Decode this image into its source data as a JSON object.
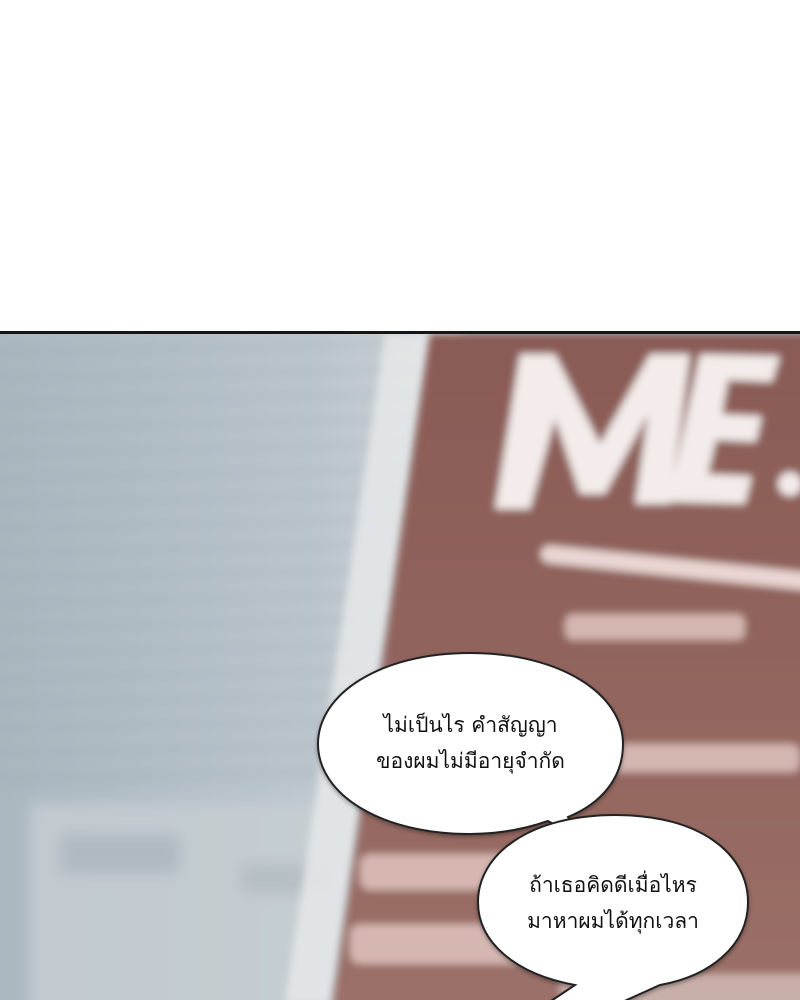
{
  "panel": {
    "sign_text": "ME",
    "bubbles": [
      {
        "lines": [
          "ไม่เป็นไร คำสัญญา",
          "ของผมไม่มีอายุจำกัด"
        ]
      },
      {
        "lines": [
          "ถ้าเธอคิดดีเมื่อไหร",
          "มาหาผมได้ทุกเวลา"
        ]
      }
    ]
  },
  "colors": {
    "wall_left": "#b4c0c8",
    "sign_board": "#8b5e5b",
    "panel_border": "#151515",
    "bubble_fill": "#ffffff",
    "bubble_stroke": "#222222"
  }
}
